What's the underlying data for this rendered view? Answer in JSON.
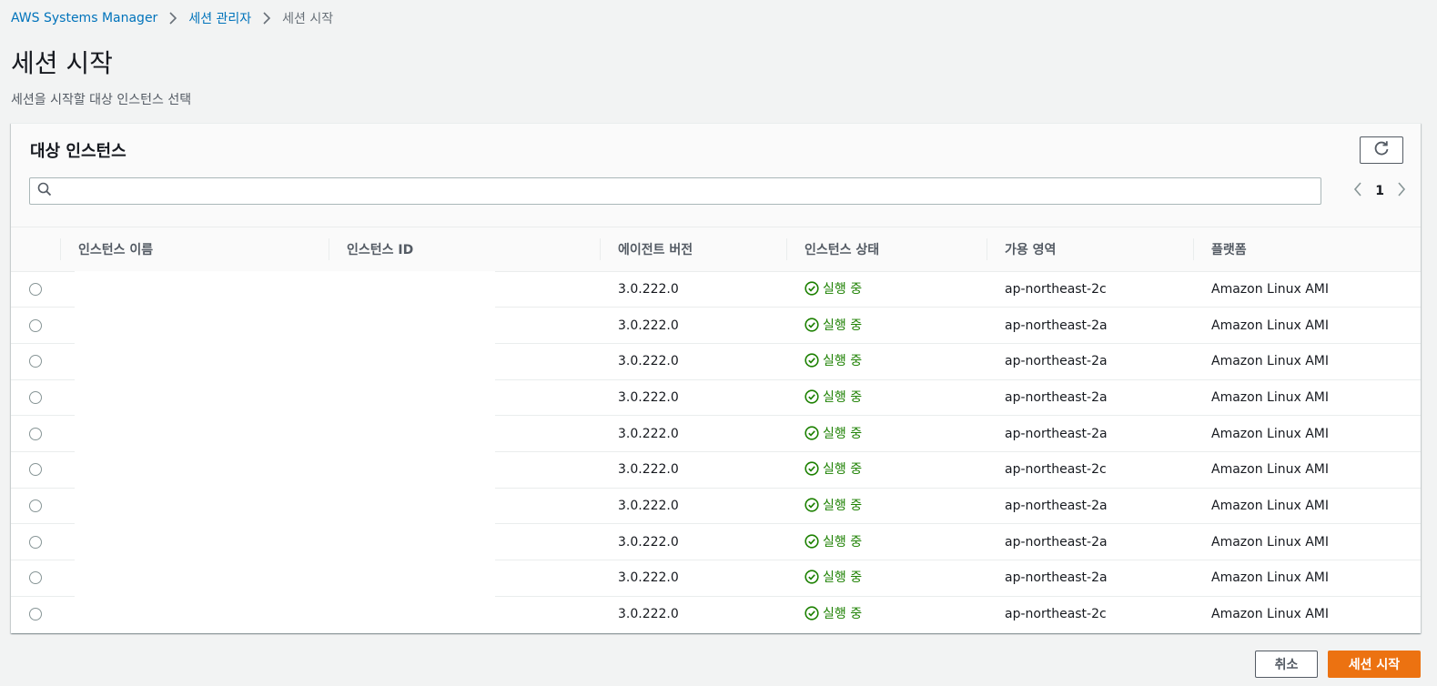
{
  "breadcrumb": {
    "items": [
      "AWS Systems Manager",
      "세션 관리자"
    ],
    "current": "세션 시작"
  },
  "page": {
    "title": "세션 시작",
    "description": "세션을 시작할 대상 인스턴스 선택"
  },
  "panel": {
    "title": "대상 인스턴스",
    "search_placeholder": "",
    "page_number": "1"
  },
  "table": {
    "columns": [
      "인스턴스 이름",
      "인스턴스 ID",
      "에이전트 버전",
      "인스턴스 상태",
      "가용 영역",
      "플랫폼"
    ],
    "rows": [
      {
        "name": "",
        "id": "",
        "agent_version": "3.0.222.0",
        "status": "실행 중",
        "az": "ap-northeast-2c",
        "platform": "Amazon Linux AMI"
      },
      {
        "name": "",
        "id": "",
        "agent_version": "3.0.222.0",
        "status": "실행 중",
        "az": "ap-northeast-2a",
        "platform": "Amazon Linux AMI"
      },
      {
        "name": "",
        "id": "",
        "agent_version": "3.0.222.0",
        "status": "실행 중",
        "az": "ap-northeast-2a",
        "platform": "Amazon Linux AMI"
      },
      {
        "name": "",
        "id": "",
        "agent_version": "3.0.222.0",
        "status": "실행 중",
        "az": "ap-northeast-2a",
        "platform": "Amazon Linux AMI"
      },
      {
        "name": "",
        "id": "",
        "agent_version": "3.0.222.0",
        "status": "실행 중",
        "az": "ap-northeast-2a",
        "platform": "Amazon Linux AMI"
      },
      {
        "name": "",
        "id": "",
        "agent_version": "3.0.222.0",
        "status": "실행 중",
        "az": "ap-northeast-2c",
        "platform": "Amazon Linux AMI"
      },
      {
        "name": "",
        "id": "",
        "agent_version": "3.0.222.0",
        "status": "실행 중",
        "az": "ap-northeast-2a",
        "platform": "Amazon Linux AMI"
      },
      {
        "name": "",
        "id": "",
        "agent_version": "3.0.222.0",
        "status": "실행 중",
        "az": "ap-northeast-2a",
        "platform": "Amazon Linux AMI"
      },
      {
        "name": "",
        "id": "",
        "agent_version": "3.0.222.0",
        "status": "실행 중",
        "az": "ap-northeast-2a",
        "platform": "Amazon Linux AMI"
      },
      {
        "name": "",
        "id": "",
        "agent_version": "3.0.222.0",
        "status": "실행 중",
        "az": "ap-northeast-2c",
        "platform": "Amazon Linux AMI"
      }
    ]
  },
  "footer": {
    "cancel_label": "취소",
    "start_label": "세션 시작"
  },
  "colors": {
    "link": "#0073bb",
    "status_running": "#1d8102",
    "primary": "#ec7211"
  },
  "icons": {
    "refresh": "refresh-icon",
    "search": "search-icon",
    "status": "check-circle-icon",
    "breadcrumb_separator": "chevron-right-icon"
  }
}
